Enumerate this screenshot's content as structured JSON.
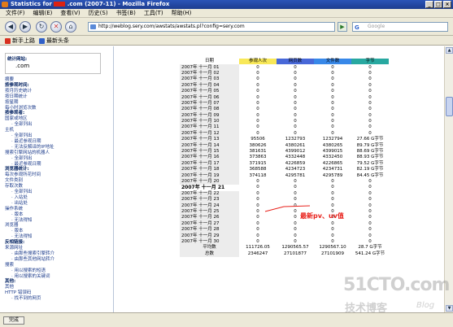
{
  "window": {
    "title_prefix": "Statistics for",
    "title_suffix": ".com (2007-11) - Mozilla Firefox"
  },
  "menu": [
    "文件(F)",
    "编辑(E)",
    "查看(V)",
    "历史(S)",
    "书签(B)",
    "工具(T)",
    "帮助(H)"
  ],
  "nav": {
    "url": "http://weblog.sery.com/awstats/awstats.pl?config=sery.com",
    "search_placeholder": "Google",
    "back_icon": "back-arrow-icon",
    "forward_icon": "forward-arrow-icon"
  },
  "bookmarks": [
    {
      "label": "新手上路",
      "color": "#d83020"
    },
    {
      "label": "最新头条",
      "color": "#3060c8"
    }
  ],
  "left_panel": {
    "site_label": "统计网站:",
    "site_value": ".com",
    "items": [
      {
        "text": "摘要",
        "kind": "link"
      },
      {
        "text": "按参观时间:",
        "kind": "head"
      },
      {
        "text": "按月历史统计",
        "kind": "link"
      },
      {
        "text": "按日期统计",
        "kind": "link"
      },
      {
        "text": "按星期",
        "kind": "link"
      },
      {
        "text": "每小时浏览次数",
        "kind": "link"
      },
      {
        "text": "按参观者:",
        "kind": "head"
      },
      {
        "text": "国家或地区",
        "kind": "link"
      },
      {
        "text": "全部列出",
        "kind": "sub"
      },
      {
        "text": "主机",
        "kind": "link"
      },
      {
        "text": "全部列出",
        "kind": "sub"
      },
      {
        "text": "最近参观日期",
        "kind": "sub"
      },
      {
        "text": "无法反解译的IP地址",
        "kind": "sub"
      },
      {
        "text": "搜索引擎网站的机器人",
        "kind": "link"
      },
      {
        "text": "全部列出",
        "kind": "sub"
      },
      {
        "text": "最近参观日期",
        "kind": "sub"
      },
      {
        "text": "浏览器统计:",
        "kind": "head"
      },
      {
        "text": "每次参观所花时间",
        "kind": "link"
      },
      {
        "text": "文件类别",
        "kind": "link"
      },
      {
        "text": "存取次数",
        "kind": "link"
      },
      {
        "text": "全部列出",
        "kind": "sub"
      },
      {
        "text": "入站处",
        "kind": "sub"
      },
      {
        "text": "出站处",
        "kind": "sub"
      },
      {
        "text": "操作系统",
        "kind": "link"
      },
      {
        "text": "版本",
        "kind": "sub"
      },
      {
        "text": "无法得知",
        "kind": "sub"
      },
      {
        "text": "浏览器",
        "kind": "link"
      },
      {
        "text": "版本",
        "kind": "sub"
      },
      {
        "text": "无法得知",
        "kind": "sub"
      },
      {
        "text": "反相链接:",
        "kind": "head"
      },
      {
        "text": "来源网址",
        "kind": "link"
      },
      {
        "text": "由那些搜索引擎转介",
        "kind": "sub"
      },
      {
        "text": "由那些其他网站转介",
        "kind": "sub"
      },
      {
        "text": "搜索",
        "kind": "link"
      },
      {
        "text": "用以搜索的短语",
        "kind": "sub"
      },
      {
        "text": "用以搜索的关键词",
        "kind": "sub"
      },
      {
        "text": "其他:",
        "kind": "head"
      },
      {
        "text": "其他",
        "kind": "link"
      },
      {
        "text": "HTTP 错误码",
        "kind": "link"
      },
      {
        "text": "找不到的网页",
        "kind": "sub"
      }
    ]
  },
  "table": {
    "headers": [
      {
        "label": "日期",
        "bg": "#ffffff"
      },
      {
        "label": "参观人次",
        "bg": "#f8e858"
      },
      {
        "label": "网页数",
        "bg": "#4868d8"
      },
      {
        "label": "文件数",
        "bg": "#3888e8"
      },
      {
        "label": "字节",
        "bg": "#28a8a0"
      }
    ],
    "rows": [
      [
        "2007年 十一月 01",
        "0",
        "0",
        "0",
        "0"
      ],
      [
        "2007年 十一月 02",
        "0",
        "0",
        "0",
        "0"
      ],
      [
        "2007年 十一月 03",
        "0",
        "0",
        "0",
        "0"
      ],
      [
        "2007年 十一月 04",
        "0",
        "0",
        "0",
        "0"
      ],
      [
        "2007年 十一月 05",
        "0",
        "0",
        "0",
        "0"
      ],
      [
        "2007年 十一月 06",
        "0",
        "0",
        "0",
        "0"
      ],
      [
        "2007年 十一月 07",
        "0",
        "0",
        "0",
        "0"
      ],
      [
        "2007年 十一月 08",
        "0",
        "0",
        "0",
        "0"
      ],
      [
        "2007年 十一月 09",
        "0",
        "0",
        "0",
        "0"
      ],
      [
        "2007年 十一月 10",
        "0",
        "0",
        "0",
        "0"
      ],
      [
        "2007年 十一月 11",
        "0",
        "0",
        "0",
        "0"
      ],
      [
        "2007年 十一月 12",
        "0",
        "0",
        "0",
        "0"
      ],
      [
        "2007年 十一月 13",
        "95506",
        "1232793",
        "1232794",
        "27.66 G字节"
      ],
      [
        "2007年 十一月 14",
        "380626",
        "4380261",
        "4380265",
        "89.79 G字节"
      ],
      [
        "2007年 十一月 15",
        "381631",
        "4399012",
        "4399015",
        "88.69 G字节"
      ],
      [
        "2007年 十一月 16",
        "373863",
        "4332448",
        "4332450",
        "88.93 G字节"
      ],
      [
        "2007年 十一月 17",
        "371915",
        "4226859",
        "4226865",
        "79.52 G字节"
      ],
      [
        "2007年 十一月 18",
        "368588",
        "4234723",
        "4234731",
        "82.19 G字节"
      ],
      [
        "2007年 十一月 19",
        "374118",
        "4295781",
        "4295789",
        "84.45 G字节"
      ],
      [
        "2007年 十一月 20",
        "0",
        "0",
        "0",
        "0"
      ],
      [
        "2007年 十一月 21",
        "0",
        "0",
        "0",
        "0"
      ],
      [
        "2007年 十一月 22",
        "0",
        "0",
        "0",
        "0"
      ],
      [
        "2007年 十一月 23",
        "0",
        "0",
        "0",
        "0"
      ],
      [
        "2007年 十一月 24",
        "0",
        "0",
        "0",
        "0"
      ],
      [
        "2007年 十一月 25",
        "0",
        "0",
        "0",
        "0"
      ],
      [
        "2007年 十一月 26",
        "0",
        "0",
        "0",
        "0"
      ],
      [
        "2007年 十一月 27",
        "0",
        "0",
        "0",
        "0"
      ],
      [
        "2007年 十一月 28",
        "0",
        "0",
        "0",
        "0"
      ],
      [
        "2007年 十一月 29",
        "0",
        "0",
        "0",
        "0"
      ],
      [
        "2007年 十一月 30",
        "0",
        "0",
        "0",
        "0"
      ],
      [
        "平均数",
        "111726.05",
        "1290565.57",
        "1290567.10",
        "28.7 G字节"
      ],
      [
        "总数",
        "2346247",
        "27101877",
        "27101909",
        "541.24 G字节"
      ]
    ],
    "highlight_row_index": 20,
    "annotation": "最新pv、uv值"
  },
  "watermark": {
    "line1": "51CTO.com",
    "line2": "技术博客",
    "line3": "Blog"
  },
  "status": {
    "done_label": "完成"
  }
}
